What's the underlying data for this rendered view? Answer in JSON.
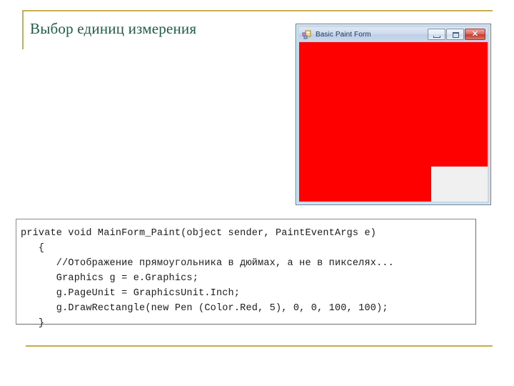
{
  "slide": {
    "title": "Выбор единиц измерения",
    "accent_color": "#c7b14a",
    "title_color": "#1f5c46"
  },
  "form_window": {
    "icon": "form-designer-icon",
    "title": "Basic Paint Form",
    "buttons": {
      "minimize": "minimize-button",
      "maximize": "maximize-button",
      "close_glyph": "✕"
    },
    "canvas": {
      "fill_color": "#fe0000",
      "background_color": "#f0f0f0"
    }
  },
  "code": {
    "language": "csharp",
    "lines": [
      "private void MainForm_Paint(object sender, PaintEventArgs e)",
      "   {",
      "      //Отображение прямоугольника в дюймах, а не в пикселях...",
      "      Graphics g = e.Graphics;",
      "      g.PageUnit = GraphicsUnit.Inch;",
      "      g.DrawRectangle(new Pen (Color.Red, 5), 0, 0, 100, 100);",
      "   }"
    ]
  }
}
